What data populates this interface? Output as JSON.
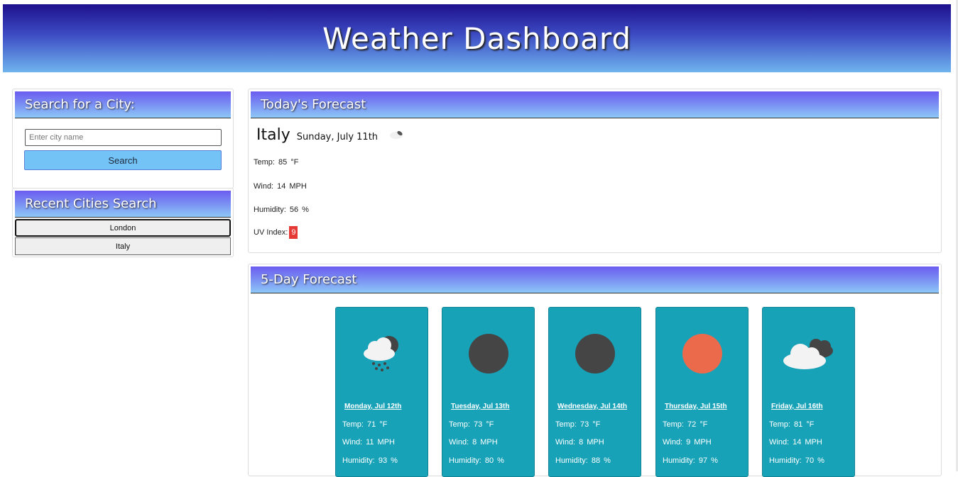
{
  "header": {
    "title": "Weather Dashboard"
  },
  "search": {
    "heading": "Search for a City:",
    "placeholder": "Enter city name",
    "button_label": "Search"
  },
  "recent": {
    "heading": "Recent Cities Search",
    "cities": [
      "London",
      "Italy"
    ]
  },
  "today": {
    "heading": "Today's Forecast",
    "city": "Italy",
    "date": "Sunday, July 11th",
    "icon": "few-clouds-icon",
    "temp_label": "Temp:",
    "temp": "85",
    "temp_unit": "°F",
    "wind_label": "Wind:",
    "wind": "14",
    "wind_unit": "MPH",
    "humidity_label": "Humidity:",
    "humidity": "56",
    "humidity_unit": "%",
    "uv_label": "UV Index:",
    "uv": "9",
    "uv_color": "#e53935"
  },
  "forecast": {
    "heading": "5-Day Forecast",
    "card_color": "#17a2b8",
    "days": [
      {
        "date": "Monday, Jul 12th",
        "icon": "rain-cloud-icon",
        "temp_label": "Temp:",
        "temp": "71",
        "temp_unit": "°F",
        "wind_label": "Wind:",
        "wind": "11",
        "wind_unit": "MPH",
        "humidity_label": "Humidity:",
        "humidity": "93",
        "humidity_unit": "%"
      },
      {
        "date": "Tuesday, Jul 13th",
        "icon": "dark-circle-icon",
        "temp_label": "Temp:",
        "temp": "73",
        "temp_unit": "°F",
        "wind_label": "Wind:",
        "wind": "8",
        "wind_unit": "MPH",
        "humidity_label": "Humidity:",
        "humidity": "80",
        "humidity_unit": "%"
      },
      {
        "date": "Wednesday, Jul 14th",
        "icon": "dark-circle-icon",
        "temp_label": "Temp:",
        "temp": "73",
        "temp_unit": "°F",
        "wind_label": "Wind:",
        "wind": "8",
        "wind_unit": "MPH",
        "humidity_label": "Humidity:",
        "humidity": "88",
        "humidity_unit": "%"
      },
      {
        "date": "Thursday, Jul 15th",
        "icon": "sun-icon",
        "temp_label": "Temp:",
        "temp": "72",
        "temp_unit": "°F",
        "wind_label": "Wind:",
        "wind": "9",
        "wind_unit": "MPH",
        "humidity_label": "Humidity:",
        "humidity": "97",
        "humidity_unit": "%"
      },
      {
        "date": "Friday, Jul 16th",
        "icon": "cloudy-icon",
        "temp_label": "Temp:",
        "temp": "81",
        "temp_unit": "°F",
        "wind_label": "Wind:",
        "wind": "14",
        "wind_unit": "MPH",
        "humidity_label": "Humidity:",
        "humidity": "70",
        "humidity_unit": "%"
      }
    ]
  }
}
